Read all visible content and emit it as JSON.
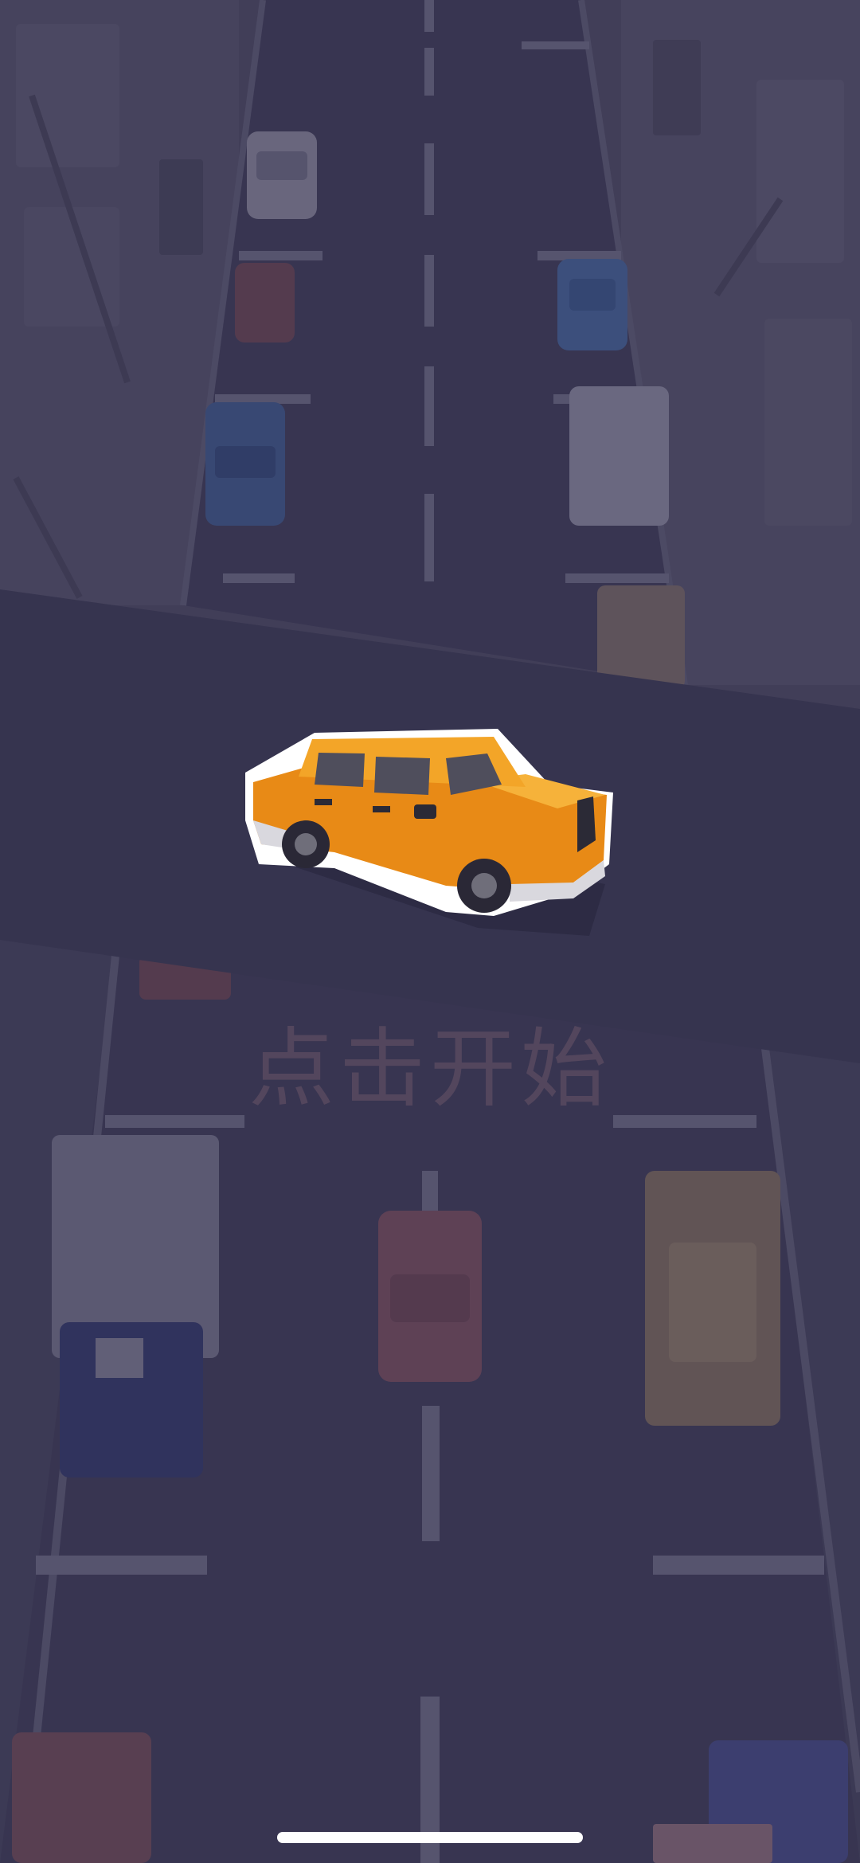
{
  "game": {
    "start_prompt": "点击开始"
  },
  "colors": {
    "road": "#3f3d58",
    "sidewalk": "#57546b",
    "lane_marking": "#6e6c84",
    "banner": "#36344f",
    "player_car": "#f0a21e",
    "overlay": "#2b2946"
  },
  "icons": {
    "player_car": "car-icon",
    "home_indicator": "home-indicator-bar"
  }
}
